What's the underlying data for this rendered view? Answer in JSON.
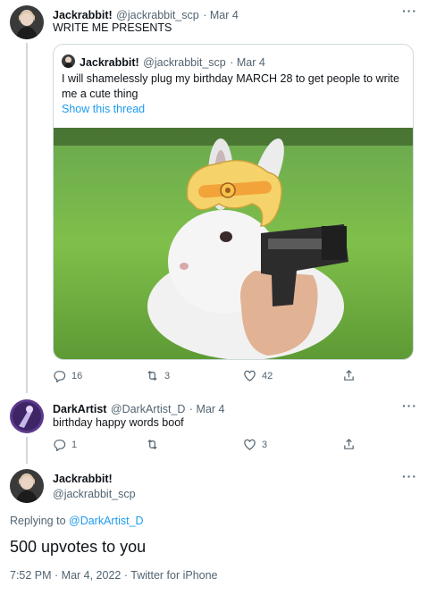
{
  "tweet1": {
    "name": "Jackrabbit!",
    "handle": "@jackrabbit_scp",
    "time": "· Mar 4",
    "text": "WRITE ME PRESENTS",
    "quote": {
      "name": "Jackrabbit!",
      "handle": "@jackrabbit_scp",
      "time": "· Mar 4",
      "text": "I will shamelessly plug my birthday MARCH 28 to get people to write me a cute thing",
      "show_thread": "Show this thread"
    },
    "actions": {
      "replies": "16",
      "retweets": "3",
      "likes": "42"
    }
  },
  "tweet2": {
    "name": "DarkArtist",
    "handle": "@DarkArtist_D",
    "time": "· Mar 4",
    "text": "birthday happy words boof",
    "actions": {
      "replies": "1",
      "retweets": "",
      "likes": "3"
    }
  },
  "main": {
    "name": "Jackrabbit!",
    "handle": "@jackrabbit_scp",
    "replying_prefix": "Replying to ",
    "replying_to": "@DarkArtist_D",
    "text": "500 upvotes to you",
    "timestamp": "7:52 PM · Mar 4, 2022 · Twitter for iPhone"
  },
  "icons": {
    "more": "more-dots-icon",
    "reply": "reply-icon",
    "retweet": "retweet-icon",
    "like": "heart-icon",
    "share": "share-icon"
  },
  "colors": {
    "link": "#1d9bf0",
    "meta": "#536471",
    "border": "#cfd9de"
  }
}
